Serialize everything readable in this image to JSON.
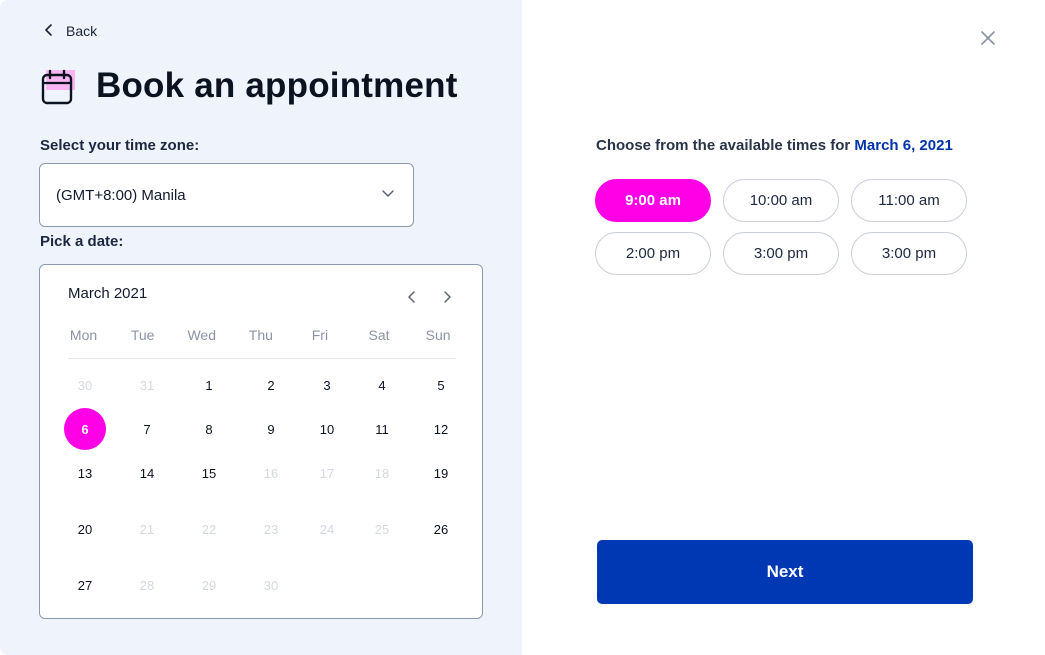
{
  "back": {
    "label": "Back"
  },
  "title": "Book an appointment",
  "timezone": {
    "label": "Select your time zone:",
    "value": "(GMT+8:00) Manila"
  },
  "date_picker": {
    "label": "Pick a date:",
    "month_label": "March 2021",
    "weekdays": [
      "Mon",
      "Tue",
      "Wed",
      "Thu",
      "Fri",
      "Sat",
      "Sun"
    ],
    "weeks": [
      [
        {
          "d": "30",
          "state": "muted"
        },
        {
          "d": "31",
          "state": "muted"
        },
        {
          "d": "1",
          "state": "available"
        },
        {
          "d": "2",
          "state": "available"
        },
        {
          "d": "3",
          "state": "available"
        },
        {
          "d": "4",
          "state": "available"
        },
        {
          "d": "5",
          "state": "available"
        }
      ],
      [
        {
          "d": "6",
          "state": "selected"
        },
        {
          "d": "7",
          "state": "available"
        },
        {
          "d": "8",
          "state": "available"
        },
        {
          "d": "9",
          "state": "available"
        },
        {
          "d": "10",
          "state": "available"
        },
        {
          "d": "11",
          "state": "available"
        },
        {
          "d": "12",
          "state": "available"
        }
      ],
      [
        {
          "d": "13",
          "state": "available"
        },
        {
          "d": "14",
          "state": "available"
        },
        {
          "d": "15",
          "state": "available"
        },
        {
          "d": "16",
          "state": "muted"
        },
        {
          "d": "17",
          "state": "muted"
        },
        {
          "d": "18",
          "state": "muted"
        },
        {
          "d": "19",
          "state": "available"
        }
      ],
      [
        {
          "d": "20",
          "state": "available"
        },
        {
          "d": "21",
          "state": "muted"
        },
        {
          "d": "22",
          "state": "muted"
        },
        {
          "d": "23",
          "state": "muted"
        },
        {
          "d": "24",
          "state": "muted"
        },
        {
          "d": "25",
          "state": "muted"
        },
        {
          "d": "26",
          "state": "available"
        }
      ],
      [
        {
          "d": "27",
          "state": "available"
        },
        {
          "d": "28",
          "state": "muted"
        },
        {
          "d": "29",
          "state": "muted"
        },
        {
          "d": "30",
          "state": "muted"
        },
        null,
        null,
        null
      ]
    ]
  },
  "times": {
    "heading_prefix": "Choose from the available times for",
    "selected_date": "March 6, 2021",
    "slots": [
      {
        "label": "9:00 am",
        "selected": true
      },
      {
        "label": "10:00 am",
        "selected": false
      },
      {
        "label": "11:00 am",
        "selected": false
      },
      {
        "label": "2:00 pm",
        "selected": false
      },
      {
        "label": "3:00 pm",
        "selected": false
      },
      {
        "label": "3:00 pm",
        "selected": false
      }
    ]
  },
  "next_button": {
    "label": "Next"
  },
  "colors": {
    "accent": "#ff00e6",
    "primary": "#0038b4",
    "panel": "#eff3fc"
  },
  "icons": [
    "chevron-left-icon",
    "calendar-icon",
    "chevron-down-icon",
    "chevron-right-icon",
    "close-icon"
  ]
}
